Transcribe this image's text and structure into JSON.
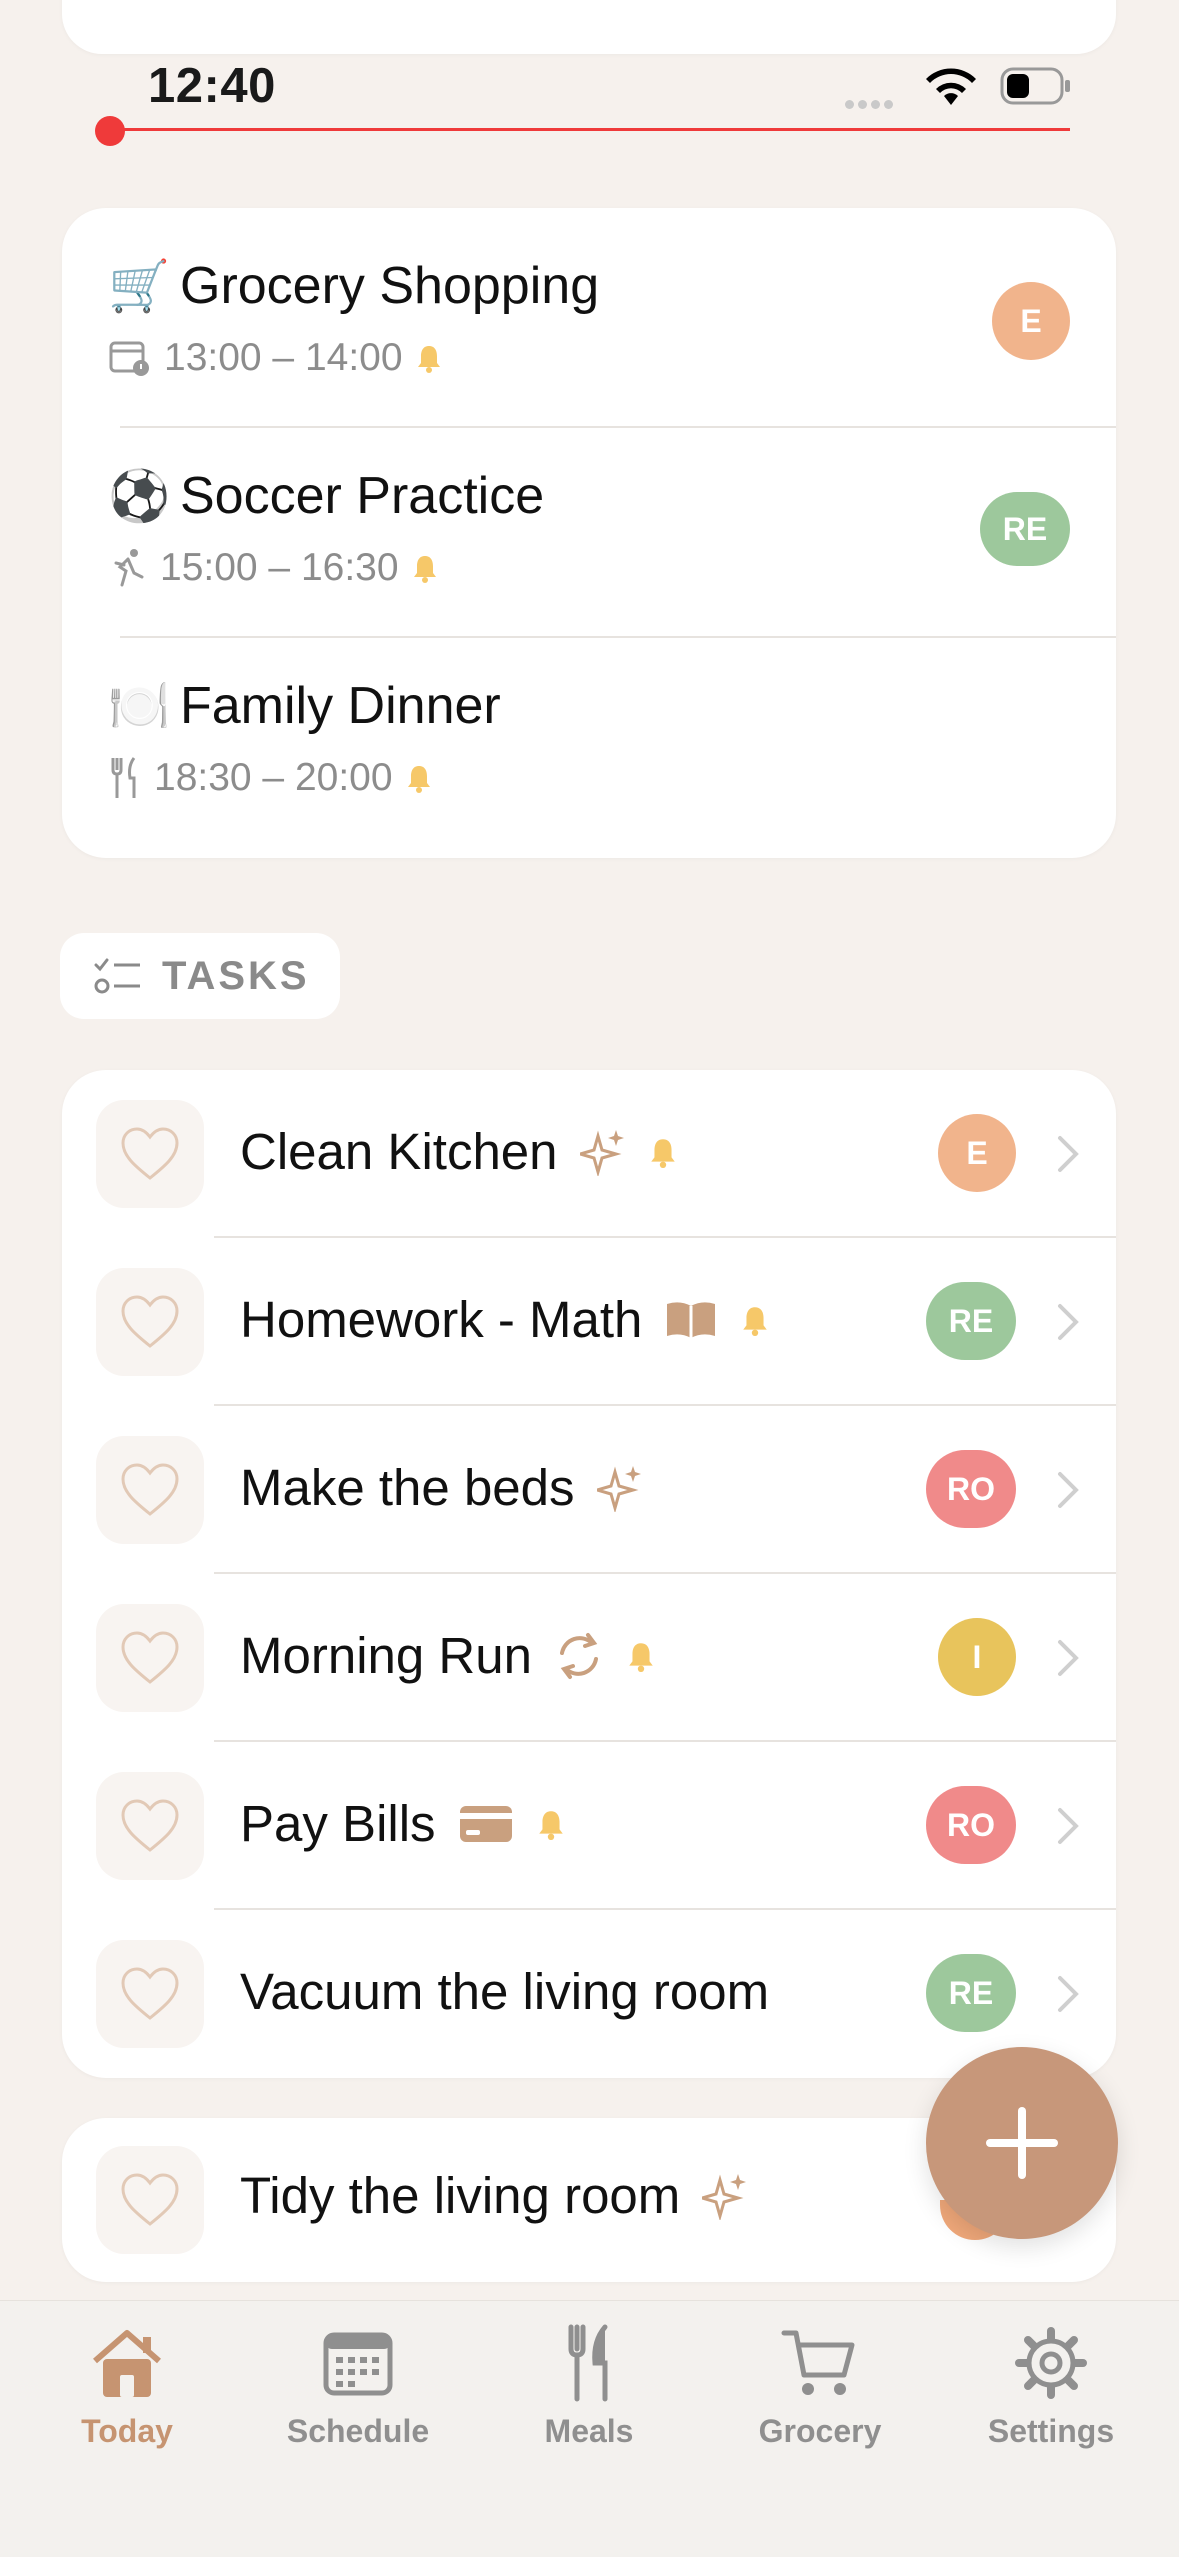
{
  "status": {
    "time": "12:40"
  },
  "events": [
    {
      "emoji": "🛒",
      "title": "Grocery Shopping",
      "time": "13:00 – 14:00",
      "avatar": "E",
      "avatar_color": "#f1b48c"
    },
    {
      "emoji": "⚽",
      "title": "Soccer Practice",
      "time": "15:00 – 16:30",
      "avatar": "RE",
      "avatar_color": "#9dc89c"
    },
    {
      "emoji": "🍽️",
      "title": "Family Dinner",
      "time": "18:30 – 20:00",
      "avatar": "",
      "avatar_color": ""
    }
  ],
  "tasks_label": "TASKS",
  "tasks": [
    {
      "title": "Clean Kitchen",
      "avatar": "E",
      "avatar_color": "#f1b48c"
    },
    {
      "title": "Homework - Math",
      "avatar": "RE",
      "avatar_color": "#9dc89c"
    },
    {
      "title": "Make the beds",
      "avatar": "RO",
      "avatar_color": "#f08a8a"
    },
    {
      "title": "Morning Run",
      "avatar": "I",
      "avatar_color": "#e8c45c"
    },
    {
      "title": "Pay Bills",
      "avatar": "RO",
      "avatar_color": "#f08a8a"
    },
    {
      "title": "Vacuum the living room",
      "avatar": "RE",
      "avatar_color": "#9dc89c"
    }
  ],
  "tidy": {
    "title": "Tidy the living room"
  },
  "tabs": [
    "Today",
    "Schedule",
    "Meals",
    "Grocery",
    "Settings"
  ],
  "colors": {
    "accent": "#c69471",
    "now_line": "#ef3a3a",
    "bell": "#f6c869"
  }
}
